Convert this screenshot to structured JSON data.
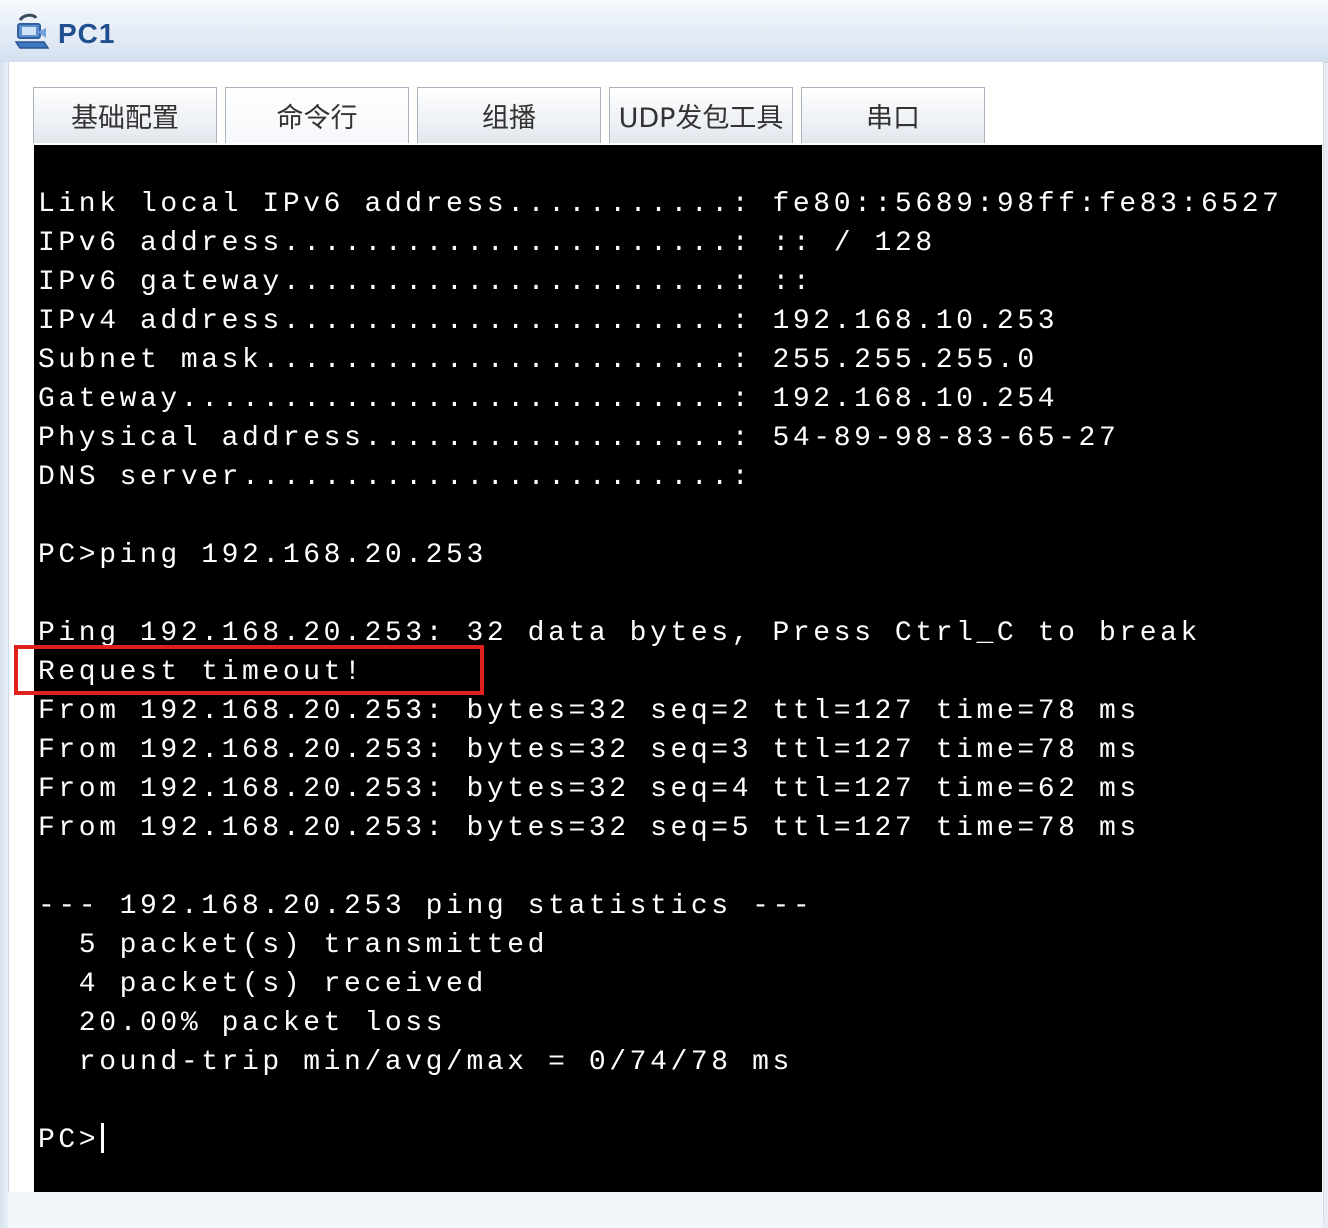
{
  "window": {
    "title": "PC1",
    "icon": "network-host-icon"
  },
  "tabs": [
    {
      "label": "基础配置"
    },
    {
      "label": "命令行"
    },
    {
      "label": "组播"
    },
    {
      "label": "UDP发包工具"
    },
    {
      "label": "串口"
    }
  ],
  "active_tab": "命令行",
  "terminal": {
    "lines": [
      "Link local IPv6 address...........: fe80::5689:98ff:fe83:6527",
      "IPv6 address......................: :: / 128",
      "IPv6 gateway......................: ::",
      "IPv4 address......................: 192.168.10.253",
      "Subnet mask.......................: 255.255.255.0",
      "Gateway...........................: 192.168.10.254",
      "Physical address..................: 54-89-98-83-65-27",
      "DNS server........................:",
      "",
      "PC>ping 192.168.20.253",
      "",
      "Ping 192.168.20.253: 32 data bytes, Press Ctrl_C to break",
      "Request timeout!",
      "From 192.168.20.253: bytes=32 seq=2 ttl=127 time=78 ms",
      "From 192.168.20.253: bytes=32 seq=3 ttl=127 time=78 ms",
      "From 192.168.20.253: bytes=32 seq=4 ttl=127 time=62 ms",
      "From 192.168.20.253: bytes=32 seq=5 ttl=127 time=78 ms",
      "",
      "--- 192.168.20.253 ping statistics ---",
      "  5 packet(s) transmitted",
      "  4 packet(s) received",
      "  20.00% packet loss",
      "  round-trip min/avg/max = 0/74/78 ms",
      ""
    ],
    "prompt": "PC>",
    "highlighted_line": "Request timeout!"
  },
  "colors": {
    "terminal_bg": "#000000",
    "terminal_fg": "#ffffff",
    "highlight": "#e0201c",
    "title_text": "#1f4f8f"
  }
}
